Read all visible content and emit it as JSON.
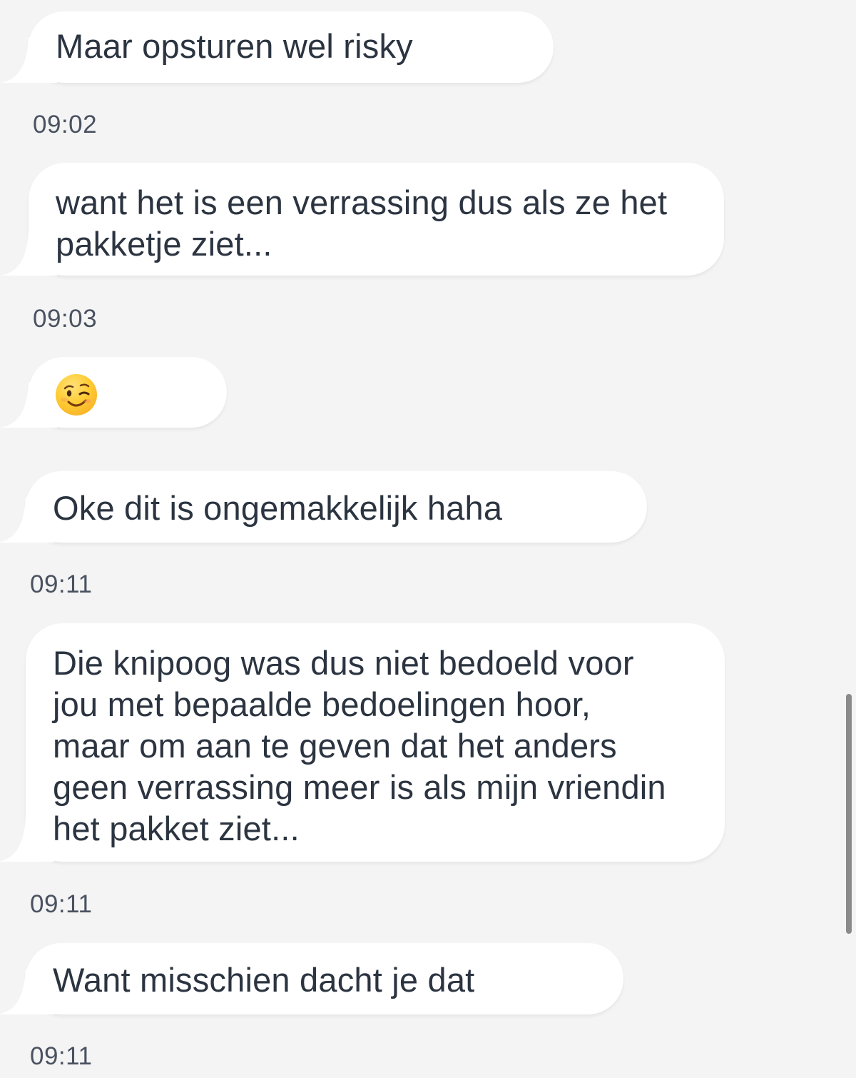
{
  "messages": [
    {
      "text": "Maar opsturen wel risky",
      "time": "09:02"
    },
    {
      "text": "want het is een verrassing dus als ze het\npakketje ziet...",
      "time": "09:03"
    },
    {
      "emoji_icon": "winking-face-emoji",
      "emoji": "😉"
    },
    {
      "text": "Oke dit is ongemakkelijk haha",
      "time": "09:11"
    },
    {
      "text": "Die knipoog was dus niet bedoeld voor\njou met bepaalde bedoelingen hoor,\nmaar om aan te geven dat het anders\ngeen verrassing meer is als mijn vriendin\nhet pakket ziet...",
      "time": "09:11"
    },
    {
      "text": "Want misschien dacht je dat",
      "time": "09:11"
    }
  ],
  "colors": {
    "background": "#f4f4f4",
    "bubble": "#ffffff",
    "text": "#2b3440",
    "timestamp": "#4a5260",
    "scrollbar": "#8a8a8a"
  }
}
